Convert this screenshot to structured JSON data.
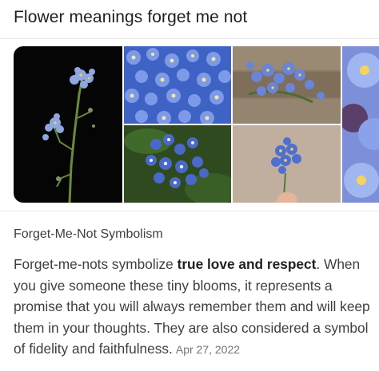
{
  "search": {
    "query": "Flower meanings forget me not"
  },
  "images": [
    {
      "icon": "forget-me-not-stem-black-background-image"
    },
    {
      "icon": "forget-me-not-field-image"
    },
    {
      "icon": "forget-me-not-on-wood-image"
    },
    {
      "icon": "forget-me-not-bunch-image"
    },
    {
      "icon": "forget-me-not-hand-image"
    },
    {
      "icon": "forget-me-not-closeup-image"
    }
  ],
  "snippet": {
    "title": "Forget-Me-Not Symbolism",
    "text_before": "Forget-me-nots symbolize ",
    "highlight": "true love and respect",
    "text_after": ". When you give someone these tiny blooms, it represents a promise that you will always remember them and will keep them in your thoughts. They are also considered a symbol of fidelity and faithfulness.",
    "date": "Apr 27, 2022"
  },
  "colors": {
    "petal_blue": "#6e8fe0",
    "petal_light": "#9fb6f0",
    "flower_center": "#f4d35e",
    "divider": "#ebebeb",
    "date_gray": "#70757a"
  }
}
